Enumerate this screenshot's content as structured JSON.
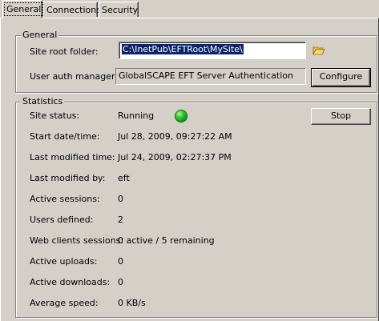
{
  "tabs": [
    {
      "label": "General",
      "active": true
    },
    {
      "label": "Connections",
      "active": false
    },
    {
      "label": "Security",
      "active": false
    }
  ],
  "general_group": {
    "title": "General",
    "site_root_label": "Site root folder:",
    "site_root_value": "C:\\InetPub\\EFTRoot\\MySite\\",
    "auth_label": "User auth manager:",
    "auth_value": "GlobalSCAPE EFT Server Authentication",
    "configure_label": "Configure",
    "browse_icon": "folder-open-icon"
  },
  "statistics_group": {
    "title": "Statistics",
    "stop_label": "Stop",
    "status_indicator_color": "#1db21a",
    "rows": [
      {
        "label": "Site status:",
        "value": "Running"
      },
      {
        "label": "Start date/time:",
        "value": "Jul 28, 2009, 09:27:22 AM"
      },
      {
        "label": "Last modified time:",
        "value": "Jul 24, 2009, 02:27:37 PM"
      },
      {
        "label": "Last modified by:",
        "value": "eft"
      },
      {
        "label": "Active sessions:",
        "value": "0"
      },
      {
        "label": "Users defined:",
        "value": "2"
      },
      {
        "label": "Web clients sessions:",
        "value": "0 active / 5 remaining"
      },
      {
        "label": "Active uploads:",
        "value": "0"
      },
      {
        "label": "Active downloads:",
        "value": "0"
      },
      {
        "label": "Average speed:",
        "value": "0 KB/s"
      }
    ]
  }
}
